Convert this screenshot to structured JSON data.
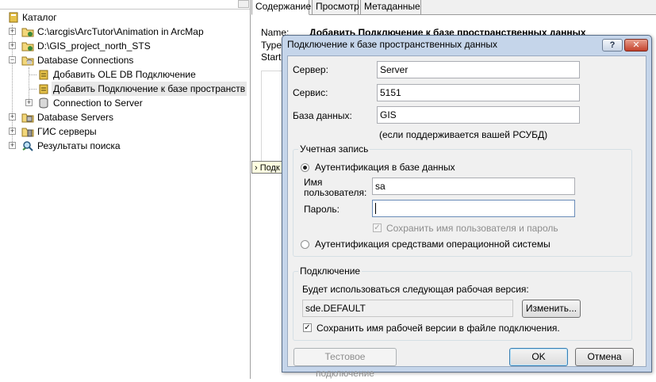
{
  "tree": {
    "root_label": "Каталог",
    "items": [
      {
        "label": "C:\\arcgis\\ArcTutor\\Animation in ArcMap",
        "expander": "+"
      },
      {
        "label": "D:\\GIS_project_north_STS",
        "expander": "+"
      },
      {
        "label": "Database Connections",
        "expander": "−"
      },
      {
        "label": "Добавить OLE DB Подключение"
      },
      {
        "label": "Добавить Подключение к базе пространств"
      },
      {
        "label": "Connection to Server",
        "expander": "+"
      },
      {
        "label": "Database Servers",
        "expander": "+"
      },
      {
        "label": "ГИС серверы",
        "expander": "+"
      },
      {
        "label": "Результаты поиска",
        "expander": "+"
      }
    ]
  },
  "tabs": [
    "Содержание",
    "Просмотр",
    "Метаданные"
  ],
  "contents": {
    "name_key": "Name:",
    "name_value": "Добавить Подключение к базе пространственных данных",
    "type_key": "Type",
    "start_key": "Start",
    "tooltip_fragment": "› Подк"
  },
  "dialog": {
    "title": "Подключение к базе пространственных данных",
    "help_glyph": "?",
    "close_glyph": "✕",
    "server_label": "Сервер:",
    "server_value": "Server",
    "service_label": "Сервис:",
    "service_value": "5151",
    "database_label": "База данных:",
    "database_value": "GIS",
    "database_hint": "(если поддерживается вашей РСУБД)",
    "account_group": "Учетная запись",
    "db_auth_label": "Аутентификация в базе данных",
    "username_label_1": "Имя",
    "username_label_2": "пользователя:",
    "username_value": "sa",
    "password_label": "Пароль:",
    "password_value": "",
    "save_credentials_label": "Сохранить имя пользователя и пароль",
    "os_auth_label": "Аутентификация средствами операционной системы",
    "connection_group": "Подключение",
    "version_hint": "Будет использоваться следующая рабочая версия:",
    "version_value": "sde.DEFAULT",
    "change_button": "Изменить...",
    "save_version_label": "Сохранить имя рабочей версии в файле подключения.",
    "test_button": "Тестовое подключение",
    "ok_button": "OK",
    "cancel_button": "Отмена"
  },
  "colors": {
    "dialog_frame": "#c5d5ea",
    "dialog_body": "#f0f0f0",
    "close_button": "#c4412b"
  }
}
